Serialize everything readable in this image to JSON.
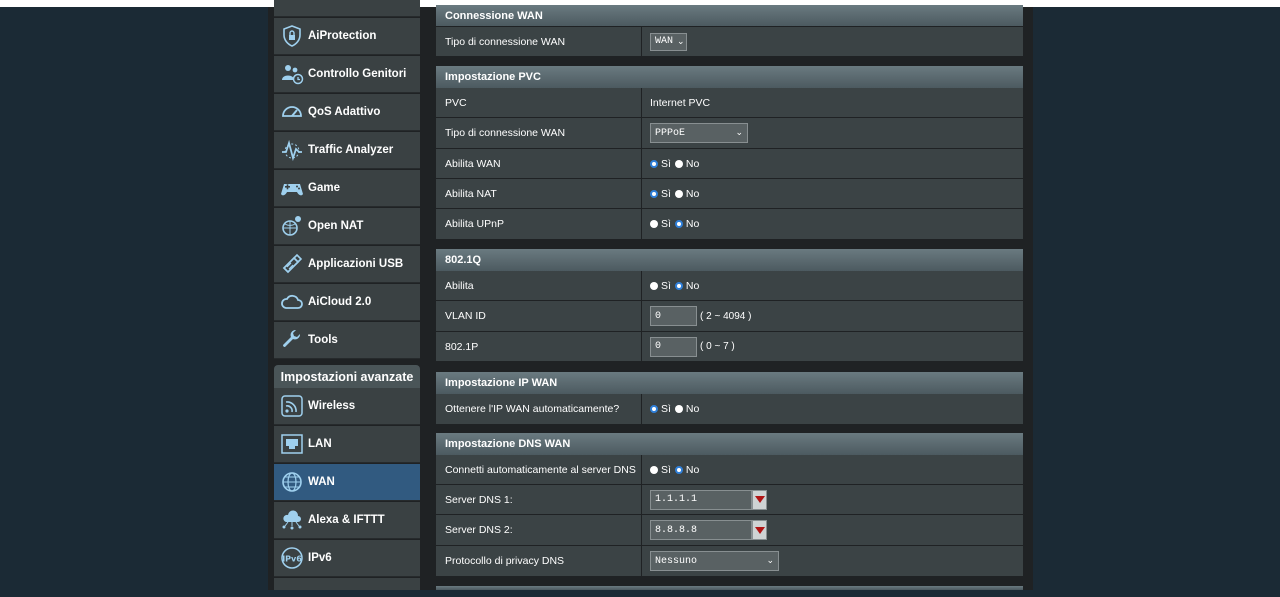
{
  "sidebar": {
    "general_items": [
      {
        "label": "AiProtection",
        "icon": "aiprotection-lock-icon"
      },
      {
        "label": "Controllo Genitori",
        "icon": "parental-control-icon"
      },
      {
        "label": "QoS Adattivo",
        "icon": "qos-speedometer-icon"
      },
      {
        "label": "Traffic Analyzer",
        "icon": "traffic-analyzer-icon"
      },
      {
        "label": "Game",
        "icon": "gamepad-icon"
      },
      {
        "label": "Open NAT",
        "icon": "open-nat-icon"
      },
      {
        "label": "Applicazioni USB",
        "icon": "usb-icon"
      },
      {
        "label": "AiCloud 2.0",
        "icon": "cloud-icon"
      },
      {
        "label": "Tools",
        "icon": "wrench-icon"
      }
    ],
    "advanced_header": "Impostazioni avanzate",
    "advanced_items": [
      {
        "label": "Wireless",
        "icon": "wireless-icon"
      },
      {
        "label": "LAN",
        "icon": "lan-icon"
      },
      {
        "label": "WAN",
        "icon": "globe-icon",
        "active": true
      },
      {
        "label": "Alexa & IFTTT",
        "icon": "alexa-ifttt-icon"
      },
      {
        "label": "IPv6",
        "icon": "ipv6-icon"
      }
    ]
  },
  "wan_connection": {
    "title": "Connessione WAN",
    "type_label": "Tipo di connessione WAN",
    "type_value": "WAN"
  },
  "pvc": {
    "title": "Impostazione PVC",
    "pvc_label": "PVC",
    "pvc_value": "Internet PVC",
    "conn_type_label": "Tipo di connessione WAN",
    "conn_type_value": "PPPoE",
    "enable_wan_label": "Abilita WAN",
    "enable_nat_label": "Abilita NAT",
    "enable_upnp_label": "Abilita UPnP"
  },
  "dot1q": {
    "title": "802.1Q",
    "enable_label": "Abilita",
    "vlan_label": "VLAN ID",
    "vlan_value": "0",
    "vlan_hint": "( 2 ~ 4094 )",
    "p_label": "802.1P",
    "p_value": "0",
    "p_hint": "( 0 ~ 7 )"
  },
  "wan_ip": {
    "title": "Impostazione IP WAN",
    "auto_label": "Ottenere l'IP WAN automaticamente?"
  },
  "dns": {
    "title": "Impostazione DNS WAN",
    "auto_label": "Connetti automaticamente al server DNS",
    "dns1_label": "Server DNS 1:",
    "dns1_value": "1.1.1.1",
    "dns2_label": "Server DNS 2:",
    "dns2_value": "8.8.8.8",
    "privacy_label": "Protocollo di privacy DNS",
    "privacy_value": "Nessuno"
  },
  "radio": {
    "yes": "Sì",
    "no": "No"
  },
  "colors": {
    "accent_blue": "#2f7fd8",
    "active_item": "#315a80",
    "panel": "#3b4345",
    "background": "#1b2a35"
  }
}
